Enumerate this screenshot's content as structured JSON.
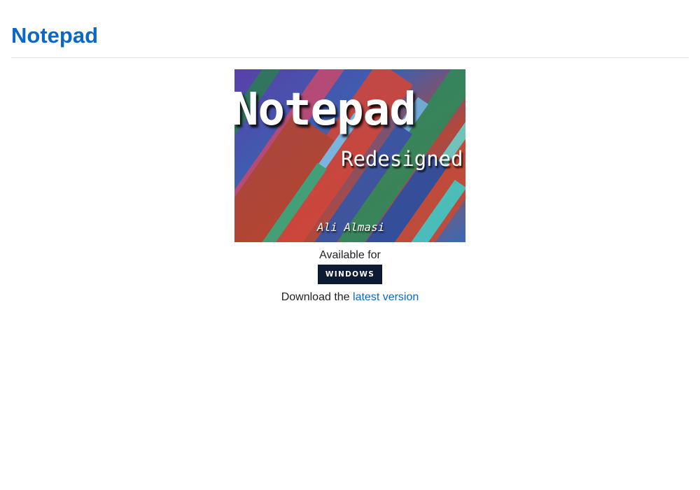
{
  "header": {
    "title": "Notepad"
  },
  "banner": {
    "title": "Notepad",
    "subtitle": "Redesigned",
    "author": "Ali Almasi",
    "colors": [
      "#3a4f9a",
      "#c0473a",
      "#2e8a5a",
      "#6fa8d8",
      "#9a3a8a"
    ]
  },
  "availability": {
    "label": "Available for",
    "platform": "WINDOWS"
  },
  "download": {
    "prefix": "Download the",
    "link_label": "latest version"
  },
  "colors": {
    "accent": "#0a68c8",
    "badge": "#0c1b33"
  }
}
